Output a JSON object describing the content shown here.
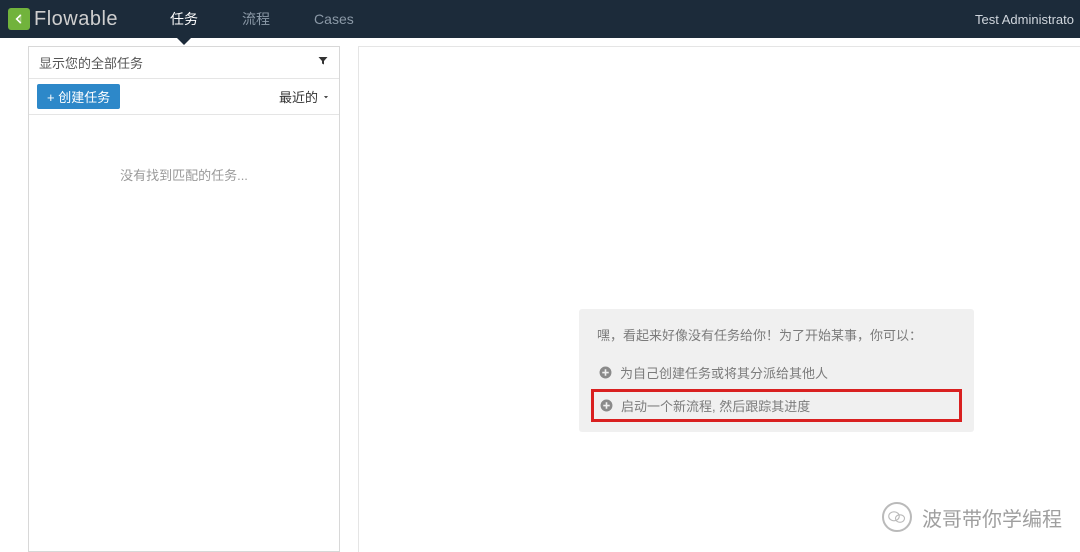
{
  "header": {
    "logo_text": "Flowable",
    "nav": [
      {
        "label": "任务",
        "active": true
      },
      {
        "label": "流程",
        "active": false
      },
      {
        "label": "Cases",
        "active": false
      }
    ],
    "user": "Test Administrato"
  },
  "sidebar": {
    "filter_label": "显示您的全部任务",
    "create_label": "+ 创建任务",
    "sort_label": "最近的",
    "empty_message": "没有找到匹配的任务..."
  },
  "main": {
    "hint_title": "嘿，看起来好像没有任务给你！为了开始某事，你可以：",
    "actions": [
      {
        "label": "为自己创建任务或将其分派给其他人",
        "highlight": false
      },
      {
        "label": "启动一个新流程, 然后跟踪其进度",
        "highlight": true
      }
    ]
  },
  "watermark": "波哥带你学编程"
}
